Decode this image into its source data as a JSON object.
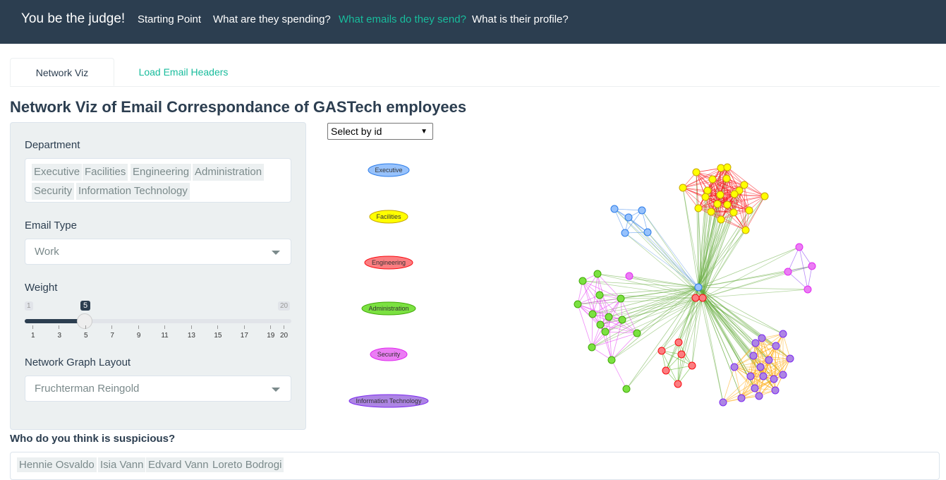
{
  "navbar": {
    "brand": "You be the judge!",
    "links": [
      "Starting Point",
      "What are they spending?",
      "What emails do they send?",
      "What is their profile?"
    ],
    "active_index": 2
  },
  "tabs": [
    "Network Viz",
    "Load Email Headers"
  ],
  "page_title": "Network Viz of Email Correspondance of GASTech employees",
  "controls": {
    "department_label": "Department",
    "departments": [
      "Executive",
      "Facilities",
      "Engineering",
      "Administration",
      "Security",
      "Information Technology"
    ],
    "email_type_label": "Email Type",
    "email_type_value": "Work",
    "weight_label": "Weight",
    "weight_min": "1",
    "weight_max": "20",
    "weight_value": "5",
    "weight_ticks": [
      "1",
      "3",
      "5",
      "7",
      "9",
      "11",
      "13",
      "15",
      "17",
      "19",
      "20"
    ],
    "layout_label": "Network Graph Layout",
    "layout_value": "Fruchterman Reingold"
  },
  "select_by_id": "Select by id",
  "legend": [
    {
      "label": "Executive",
      "color": "#97c2fc",
      "stroke": "#2b7ce9"
    },
    {
      "label": "Facilities",
      "color": "#ffff00",
      "stroke": "#c7a500"
    },
    {
      "label": "Engineering",
      "color": "#fb7e81",
      "stroke": "#fa0a10"
    },
    {
      "label": "Administration",
      "color": "#7be141",
      "stroke": "#41a906"
    },
    {
      "label": "Security",
      "color": "#eb7df4",
      "stroke": "#e129f0"
    },
    {
      "label": "Information Technology",
      "color": "#ad85e4",
      "stroke": "#7c29f0"
    }
  ],
  "suspicious_label": "Who do you think is suspicious?",
  "suspects": [
    "Hennie Osvaldo",
    "Isia Vann",
    "Edvard Vann",
    "Loreto Bodrogi"
  ]
}
